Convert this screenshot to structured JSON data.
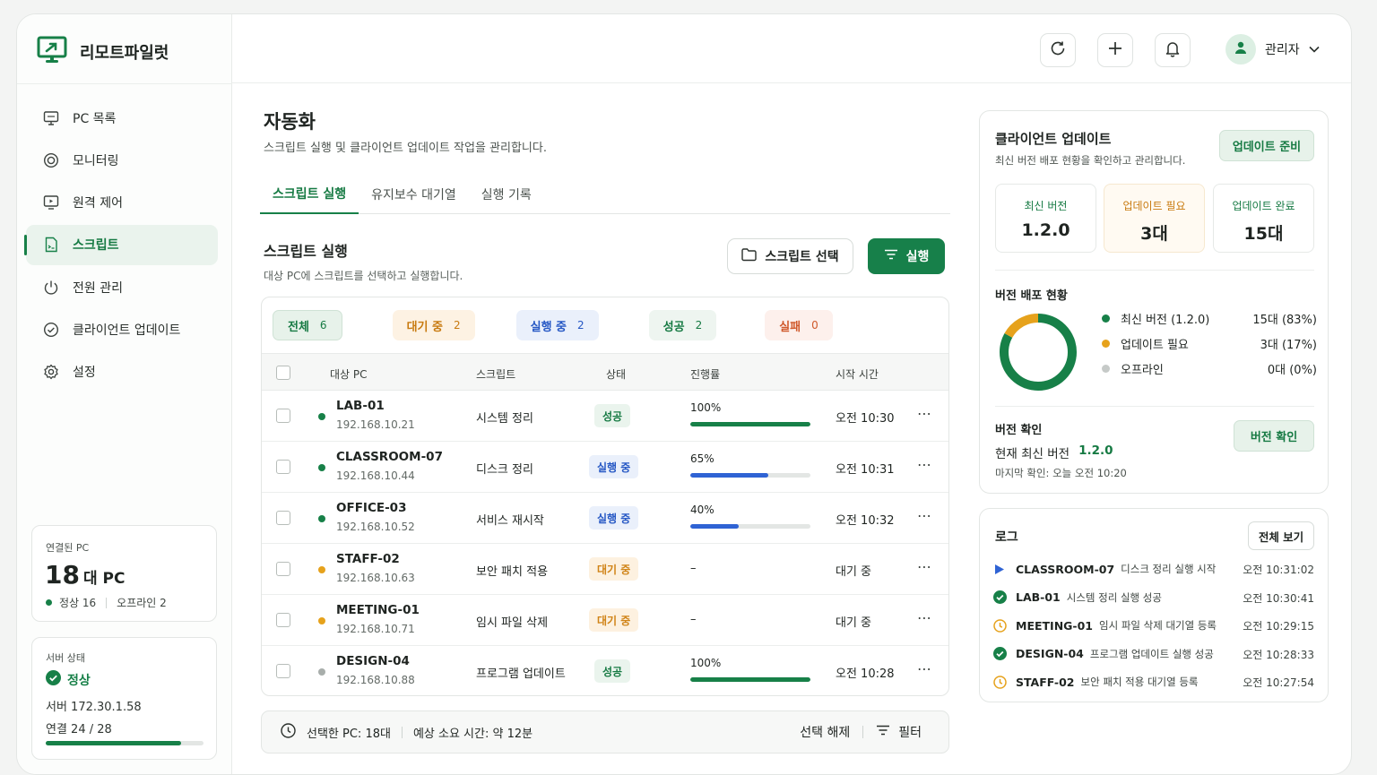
{
  "app": {
    "name": "리모트파일럿"
  },
  "sidebar": {
    "items": [
      {
        "label": "PC 목록",
        "icon": "monitor-icon"
      },
      {
        "label": "모니터링",
        "icon": "target-icon"
      },
      {
        "label": "원격 제어",
        "icon": "remote-icon"
      },
      {
        "label": "스크립트",
        "icon": "script-icon",
        "active": true
      },
      {
        "label": "전원 관리",
        "icon": "power-icon"
      },
      {
        "label": "클라이언트 업데이트",
        "icon": "update-icon"
      },
      {
        "label": "설정",
        "icon": "gear-icon"
      }
    ],
    "connected": {
      "label": "연결된 PC",
      "count": "18",
      "unit": "대 PC",
      "online": "정상 16",
      "offline": "오프라인 2"
    },
    "server": {
      "label": "서버 상태",
      "status": "정상",
      "address": "서버 172.30.1.58",
      "connections": "연결 24 / 28",
      "usage_ratio": 0.857
    }
  },
  "header": {
    "user": "관리자"
  },
  "main": {
    "title": "자동화",
    "subtitle": "스크립트 실행 및 클라이언트 업데이트 작업을 관리합니다.",
    "tabs": [
      "스크립트 실행",
      "유지보수 대기열",
      "실행 기록"
    ],
    "section_title": "스크립트 실행",
    "section_sub": "대상 PC에 스크립트를 선택하고 실행합니다.",
    "select_button": "스크립트 선택",
    "run_button": "실행",
    "filters": [
      {
        "label": "전체",
        "count": "6"
      },
      {
        "label": "대기 중",
        "count": "2"
      },
      {
        "label": "실행 중",
        "count": "2"
      },
      {
        "label": "성공",
        "count": "2"
      },
      {
        "label": "실패",
        "count": "0"
      }
    ],
    "columns": [
      "대상 PC",
      "스크립트",
      "상태",
      "진행률",
      "시작 시간"
    ],
    "rows": [
      {
        "name": "LAB-01",
        "ip": "192.168.10.21",
        "script": "시스템 정리",
        "status": "성공",
        "progress": "100%",
        "time": "오전 10:30"
      },
      {
        "name": "CLASSROOM-07",
        "ip": "192.168.10.44",
        "script": "디스크 정리",
        "status": "실행 중",
        "progress": "65%",
        "time": "오전 10:31"
      },
      {
        "name": "OFFICE-03",
        "ip": "192.168.10.52",
        "script": "서비스 재시작",
        "status": "실행 중",
        "progress": "40%",
        "time": "오전 10:32"
      },
      {
        "name": "STAFF-02",
        "ip": "192.168.10.63",
        "script": "보안 패치 적용",
        "status": "대기 중",
        "progress": "–",
        "time": "대기 중"
      },
      {
        "name": "MEETING-01",
        "ip": "192.168.10.71",
        "script": "임시 파일 삭제",
        "status": "대기 중",
        "progress": "–",
        "time": "대기 중"
      },
      {
        "name": "DESIGN-04",
        "ip": "192.168.10.88",
        "script": "프로그램 업데이트",
        "status": "성공",
        "progress": "100%",
        "time": "오전 10:28"
      }
    ],
    "bottom": {
      "selected": "선택한 PC: 18대",
      "estimate": "예상 소요 시간: 약 12분",
      "clear": "선택 해제",
      "filter": "필터"
    }
  },
  "update_panel": {
    "title": "클라이언트 업데이트",
    "subtitle": "최신 버전 배포 현황을 확인하고 관리합니다.",
    "prepare_button": "업데이트 준비",
    "stats": [
      {
        "label": "최신 버전",
        "value": "1.2.0"
      },
      {
        "label": "업데이트 필요",
        "value": "3대"
      },
      {
        "label": "업데이트 완료",
        "value": "15대"
      }
    ],
    "distribution_title": "버전 배포 현황",
    "distribution": [
      {
        "label": "최신 버전 (1.2.0)",
        "value": "15대 (83%)",
        "fraction": 0.83,
        "color": "#178048"
      },
      {
        "label": "업데이트 필요",
        "value": "3대 (17%)",
        "fraction": 0.17,
        "color": "#e6a21c"
      },
      {
        "label": "오프라인",
        "value": "0대 (0%)",
        "fraction": 0,
        "color": "#c6cac8"
      }
    ],
    "check_title": "버전 확인",
    "check_current_label": "현재 최신 버전",
    "check_current_value": "1.2.0",
    "check_last": "마지막 확인: 오늘 오전 10:20",
    "check_button": "버전 확인"
  },
  "log_panel": {
    "title": "로그",
    "view_all": "전체 보기",
    "entries": [
      {
        "pc": "CLASSROOM-07",
        "msg": "디스크 정리 실행 시작",
        "time": "오전 10:31:02",
        "icon": "play-icon"
      },
      {
        "pc": "LAB-01",
        "msg": "시스템 정리 실행 성공",
        "time": "오전 10:30:41",
        "icon": "check-icon"
      },
      {
        "pc": "MEETING-01",
        "msg": "임시 파일 삭제 대기열 등록",
        "time": "오전 10:29:15",
        "icon": "clock-icon"
      },
      {
        "pc": "DESIGN-04",
        "msg": "프로그램 업데이트 실행 성공",
        "time": "오전 10:28:33",
        "icon": "check-icon"
      },
      {
        "pc": "STAFF-02",
        "msg": "보안 패치 적용 대기열 등록",
        "time": "오전 10:27:54",
        "icon": "clock-icon"
      }
    ]
  }
}
